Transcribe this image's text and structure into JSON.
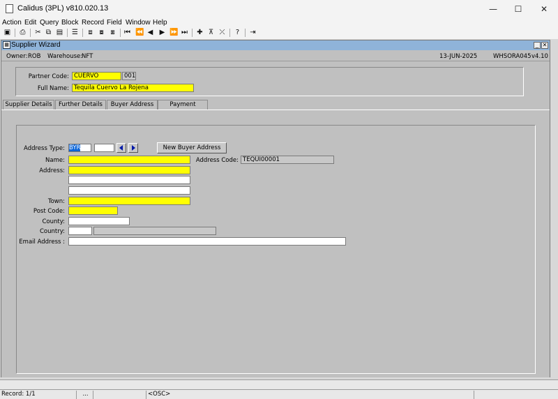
{
  "window": {
    "title": "Calidus (3PL) v810.020.13",
    "minimize": "—",
    "maximize": "☐",
    "close": "✕"
  },
  "menu": [
    "Action",
    "Edit",
    "Query",
    "Block",
    "Record",
    "Field",
    "Window",
    "Help"
  ],
  "toolbar_icons": [
    "save-icon",
    "print-icon",
    "cut-icon",
    "copy-icon",
    "paste-icon",
    "clear-icon",
    "enter-query-icon",
    "execute-query-icon",
    "count-query-icon",
    "first-record-icon",
    "previous-set-icon",
    "previous-record-icon",
    "next-record-icon",
    "next-set-icon",
    "last-record-icon",
    "insert-record-icon",
    "delete-record-icon",
    "clear-record-icon",
    "help-icon",
    "exit-icon"
  ],
  "form": {
    "title": "Supplier Wizard",
    "info": {
      "owner_label": "Owner:",
      "owner": "ROB",
      "warehouse_label": "Warehouse:",
      "warehouse": "NFT",
      "date": "13-JUN-2025",
      "module": "WHSORA045",
      "version": "v4.10"
    },
    "header": {
      "partner_code_label": "Partner Code:",
      "partner_code": "CUERVO",
      "partner_suffix": "001",
      "full_name_label": "Full Name:",
      "full_name": "Tequila Cuervo La Rojena"
    },
    "tabs": [
      "Supplier Details",
      "Further Details",
      "Buyer Address",
      "Payment Address"
    ],
    "active_tab": "Buyer Address",
    "buyer": {
      "address_type_label": "Address Type:",
      "address_type": "BYR",
      "new_button": "New Buyer Address",
      "address_code_label": "Address Code:",
      "address_code": "TEQUI00001",
      "name_label": "Name:",
      "address_label": "Address:",
      "town_label": "Town:",
      "post_code_label": "Post Code:",
      "county_label": "County:",
      "country_label": "Country:",
      "email_label": "Email Address :"
    }
  },
  "status": {
    "record": "Record: 1/1",
    "dots": "...",
    "osc": "<OSC>"
  }
}
